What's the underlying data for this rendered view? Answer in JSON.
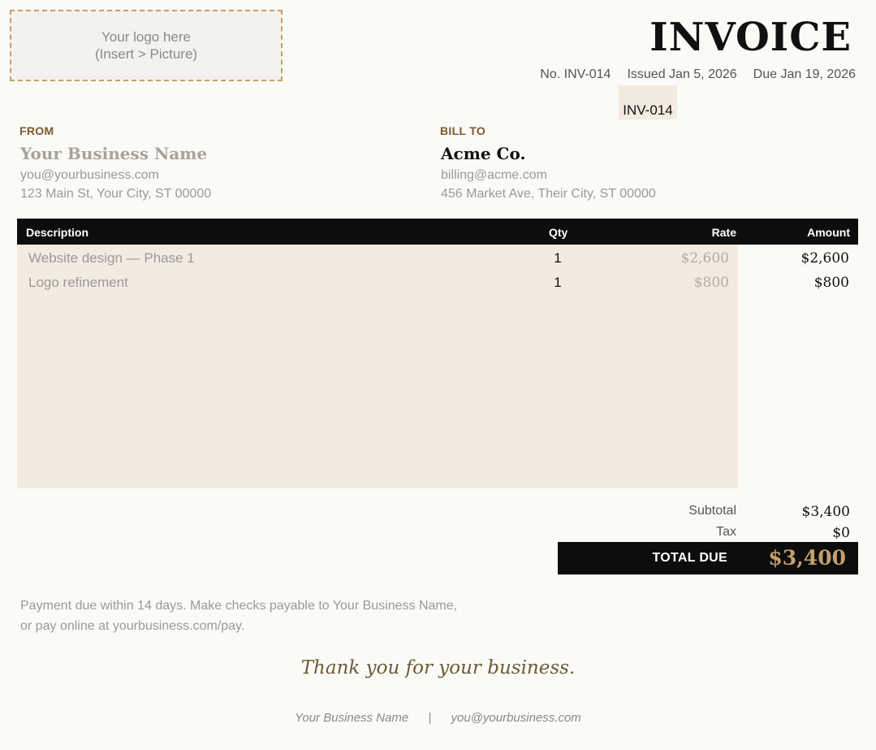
{
  "logo": {
    "line1": "Your logo here",
    "line2": "(Insert > Picture)"
  },
  "header": {
    "title": "INVOICE",
    "number": "No. INV-014",
    "issued": "Issued Jan 5, 2026",
    "due": "Due Jan 19, 2026",
    "selected_cell_value": "INV-014"
  },
  "from": {
    "label": "FROM",
    "name": "Your Business Name",
    "email": "you@yourbusiness.com",
    "address": "123 Main St, Your City, ST 00000"
  },
  "bill_to": {
    "label": "BILL TO",
    "name": "Acme Co.",
    "email": "billing@acme.com",
    "address": "456 Market Ave, Their City, ST 00000"
  },
  "table": {
    "headers": {
      "description": "Description",
      "qty": "Qty",
      "rate": "Rate",
      "amount": "Amount"
    },
    "rows": [
      {
        "description": "Website design — Phase 1",
        "qty": "1",
        "rate": "$2,600",
        "amount": "$2,600"
      },
      {
        "description": "Logo refinement",
        "qty": "1",
        "rate": "$800",
        "amount": "$800"
      }
    ]
  },
  "totals": {
    "subtotal_label": "Subtotal",
    "subtotal": "$3,400",
    "tax_label": "Tax",
    "tax": "$0",
    "total_label": "TOTAL DUE",
    "total": "$3,400"
  },
  "note": {
    "line1": "Payment due within 14 days. Make checks payable to Your Business Name,",
    "line2": "or pay online at yourbusiness.com/pay."
  },
  "thanks": "Thank you for your business.",
  "footer": {
    "name": "Your Business Name",
    "sep": "|",
    "email": "you@yourbusiness.com"
  },
  "colors": {
    "accent": "#c4a06a",
    "label_brown": "#7a5a2c",
    "input_fill": "#f3ebe0",
    "header_bg": "#0d0d0d"
  }
}
